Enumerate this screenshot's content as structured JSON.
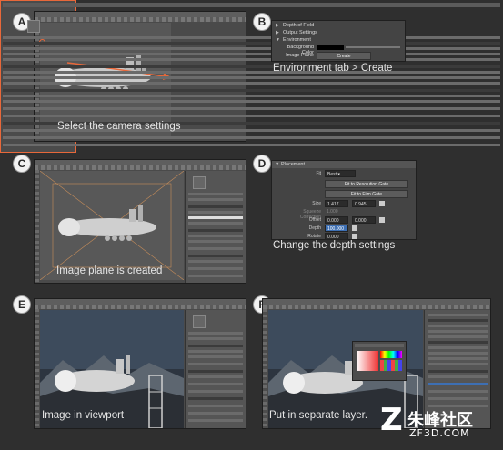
{
  "panels": {
    "a": {
      "badge": "A",
      "caption": "Select the camera settings",
      "accent": "#e8683a"
    },
    "b": {
      "badge": "B",
      "caption": "Environment tab > Create",
      "rows": [
        "Depth of Field",
        "Output Settings",
        "Environment"
      ],
      "background_color_label": "Background Color",
      "image_plane_label": "Image Plane",
      "create_label": "Create"
    },
    "c": {
      "badge": "C",
      "caption": "Image plane is created"
    },
    "d": {
      "badge": "D",
      "caption": "Change the depth settings",
      "section": "Placement",
      "fit_label": "Fit",
      "fit_value": "Best",
      "fit_resolution": "Fit to Resolution Gate",
      "fit_film": "Fit to Film Gate",
      "size_label": "Size",
      "size_x": "1.417",
      "size_y": "0.945",
      "squeeze_label": "Squeeze Correction",
      "squeeze_value": "1.000",
      "offset_label": "Offset",
      "offset_x": "0.000",
      "offset_y": "0.000",
      "depth_label": "Depth",
      "depth_value": "100.000",
      "rotate_label": "Rotate",
      "rotate_value": "0.000"
    },
    "e": {
      "badge": "E",
      "caption": "Image in viewport"
    },
    "f": {
      "badge": "F",
      "caption": "Put in separate layer."
    }
  },
  "watermark": {
    "text": "朱峰社区",
    "sub": "ZF3D.COM"
  }
}
